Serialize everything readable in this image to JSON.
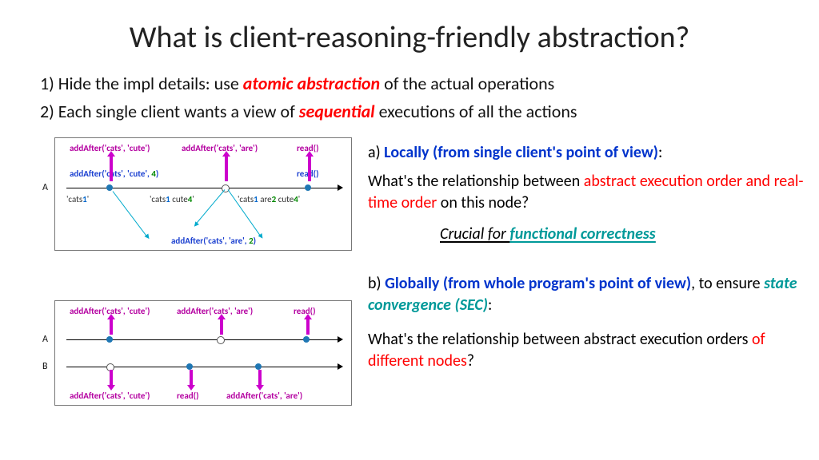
{
  "title": "What is client-reasoning-friendly abstraction?",
  "bullet1_prefix": "1) Hide the impl details: use ",
  "bullet1_em": "atomic abstraction",
  "bullet1_suffix": " of the actual operations",
  "bullet2_prefix": "2) Each single client wants a view of ",
  "bullet2_em": "sequential",
  "bullet2_suffix": " executions of all the actions",
  "sectionA": {
    "lead": "a) ",
    "head": "Locally (from single client's point of view)",
    "colon": ":",
    "q_pre": "What's the relationship between ",
    "q_em": "abstract execution order and real-time order",
    "q_suf": " on this node?",
    "crucial_pre": "Crucial for ",
    "crucial_em": "functional correctness"
  },
  "sectionB": {
    "lead": "b) ",
    "head": "Globally (from whole program's point of view)",
    "mid": ", to ensure ",
    "sec": "state convergence (SEC)",
    "colon": ":",
    "q_pre": "What's the relationship between abstract execution orders ",
    "q_em": "of different nodes",
    "q_suf": "?"
  },
  "diagram1": {
    "rowLabel": "A",
    "ops": {
      "aa_cute": "addAfter('cats', 'cute')",
      "aa_are": "addAfter('cats', 'are')",
      "read": "read()",
      "aa_cute_id": "addAfter('cats', 'cute', ",
      "aa_cute_id_n": "4",
      "aa_cute_id_suf": ")",
      "read2": "read()",
      "aa_are_id_pre": "addAfter('cats', 'are', ",
      "aa_are_id_n": "2",
      "aa_are_id_suf": ")"
    },
    "states": {
      "s1_a": "'cats",
      "s1_n": "1",
      "s1_b": "'",
      "s2_a": "'cats",
      "s2_n1": "1",
      "s2_b": " cute",
      "s2_n2": "4",
      "s2_c": "'",
      "s3_a": "'cats",
      "s3_n1": "1",
      "s3_b": " are",
      "s3_n2": "2",
      "s3_c": " cute",
      "s3_n3": "4",
      "s3_d": "'"
    }
  },
  "diagram2": {
    "rowA": "A",
    "rowB": "B",
    "ops": {
      "aa_cute": "addAfter('cats', 'cute')",
      "aa_are_top": "addAfter('cats', 'are')",
      "read_top": "read()",
      "aa_cute_bot": "addAfter('cats', 'cute')",
      "read_bot": "read()",
      "aa_are_bot": "addAfter('cats', 'are')"
    }
  }
}
